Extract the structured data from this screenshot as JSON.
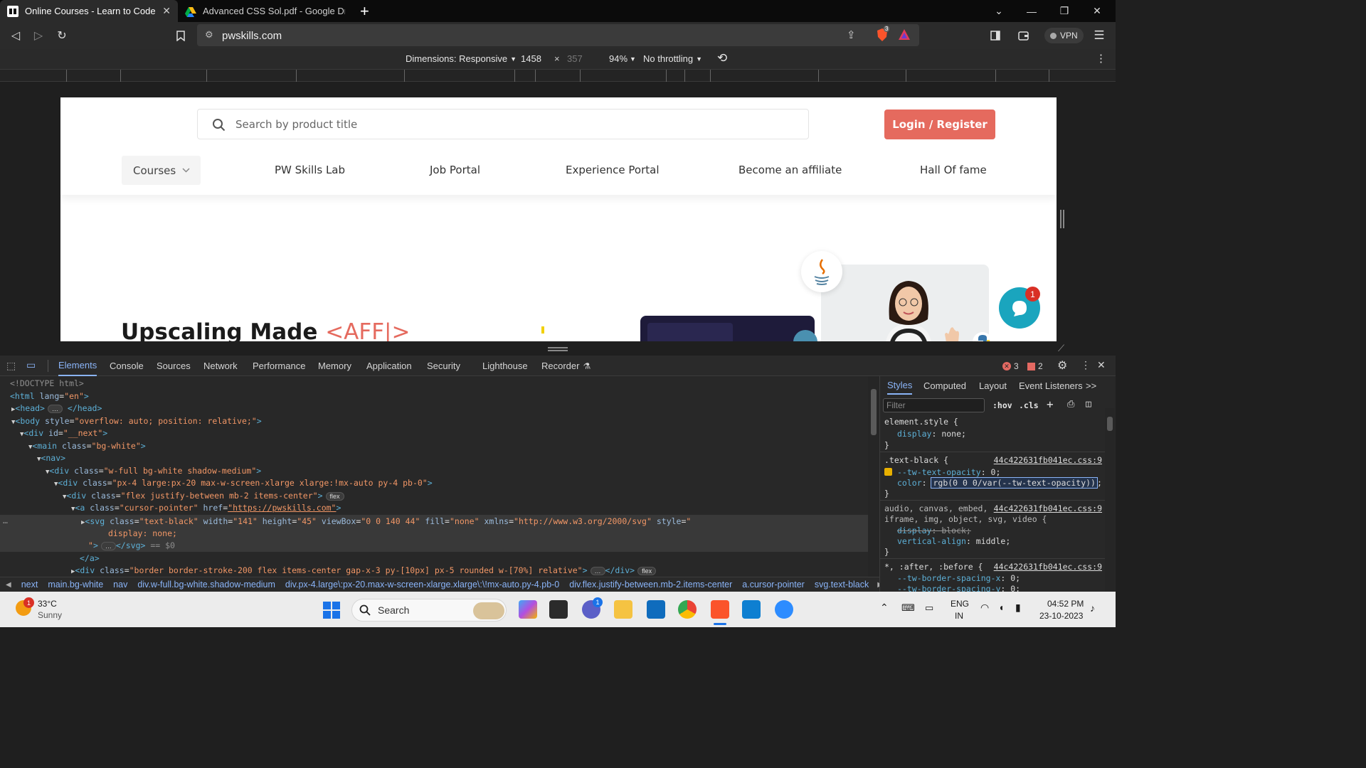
{
  "browser": {
    "tabs": [
      {
        "title": "Online Courses - Learn to Code A",
        "active": true
      },
      {
        "title": "Advanced CSS Sol.pdf - Google Drive",
        "active": false
      }
    ],
    "new_tab": "+",
    "url": "pwskills.com",
    "vpn_label": "VPN",
    "shield_count": "3"
  },
  "device_toolbar": {
    "dimensions_label": "Dimensions: Responsive",
    "width": "1458",
    "times": "×",
    "height": "357",
    "zoom": "94%",
    "throttling": "No throttling"
  },
  "site": {
    "search_placeholder": "Search by product title",
    "login_label": "Login / Register",
    "courses_label": "Courses",
    "nav_links": [
      "PW Skills Lab",
      "Job Portal",
      "Experience Portal",
      "Become an affiliate",
      "Hall Of fame"
    ],
    "hero_text": "Upscaling Made",
    "hero_accent": "<AFF|>",
    "chat_badge": "1"
  },
  "devtools": {
    "tabs": [
      "Elements",
      "Console",
      "Sources",
      "Network",
      "Performance",
      "Memory",
      "Application",
      "Security",
      "Lighthouse",
      "Recorder"
    ],
    "active_tab": "Elements",
    "error_count": "3",
    "issue_count": "2",
    "dom_lines": {
      "l1": "<!DOCTYPE html>",
      "selected_marker": "== $0"
    },
    "styles_tabs": [
      "Styles",
      "Computed",
      "Layout",
      "Event Listeners"
    ],
    "styles_more": ">>",
    "filter_placeholder": "Filter",
    "hov": ":hov",
    "cls": ".cls",
    "css_file": "44c422631fb041ec.css:9",
    "breadcrumbs": [
      "next",
      "main.bg-white",
      "nav",
      "div.w-full.bg-white.shadow-medium",
      "div.px-4.large\\:px-20.max-w-screen-xlarge.xlarge\\:\\!mx-auto.py-4.pb-0",
      "div.flex.justify-between.mb-2.items-center",
      "a.cursor-pointer",
      "svg.text-black"
    ]
  },
  "taskbar": {
    "weather_temp": "33°C",
    "weather_desc": "Sunny",
    "weather_badge": "1",
    "search_label": "Search",
    "lang1": "ENG",
    "lang2": "IN",
    "time": "04:52 PM",
    "date": "23-10-2023",
    "teams_badge": "1"
  },
  "colors": {
    "accent": "#e56a5e",
    "devtools_blue": "#8ab4f8",
    "chat": "#1aa5be"
  }
}
